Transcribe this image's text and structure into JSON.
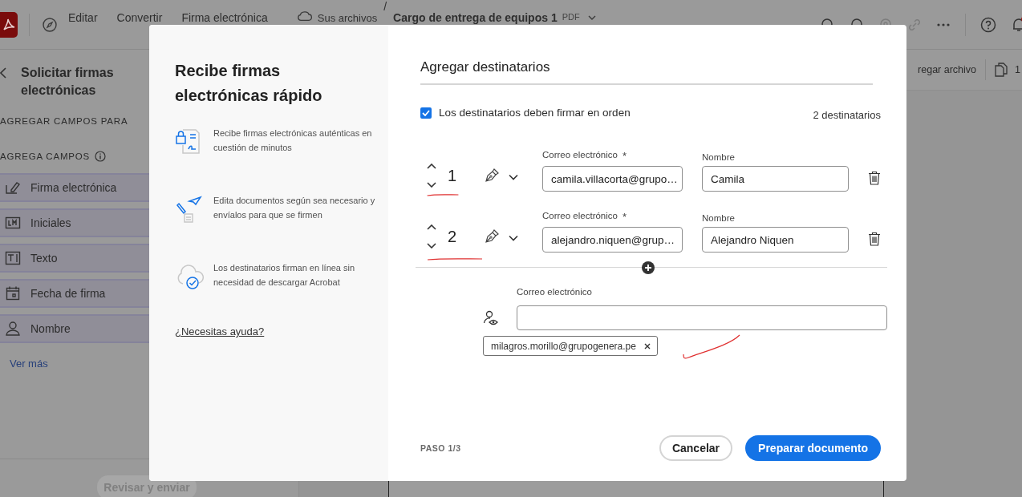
{
  "toolbar": {
    "items": [
      "Editar",
      "Convertir",
      "Firma electrónica"
    ],
    "breadcrumb": "Sus archivos",
    "separator": "/",
    "file_name": "Cargo de entrega de equipos 1",
    "file_type": "PDF",
    "has_notification": true
  },
  "side_panel": {
    "title": "Solicitar firmas electrónicas",
    "section": "AGREGAR CAMPOS PARA",
    "fields_heading": "AGREGA CAMPOS",
    "fields": [
      {
        "kind": "signature",
        "label": "Firma electrónica"
      },
      {
        "kind": "initials",
        "label": "Iniciales"
      },
      {
        "kind": "text",
        "label": "Texto"
      },
      {
        "kind": "date",
        "label": "Fecha de firma"
      },
      {
        "kind": "name",
        "label": "Nombre"
      }
    ],
    "more": "Ver más",
    "review_button": {
      "label": "Revisar y enviar",
      "disabled": true
    }
  },
  "document_toolbar": {
    "add_file": "regar archivo",
    "page_count": "1"
  },
  "dialog": {
    "intro": {
      "title": "Recibe firmas electrónicas rápido",
      "features": [
        {
          "kind": "secure",
          "text": "Recibe firmas electrónicas auténticas en cuestión de minutos"
        },
        {
          "kind": "send",
          "text": "Edita documentos según sea necesario y envíalos para que se firmen"
        },
        {
          "kind": "cloud",
          "text": "Los destinatarios firman en línea sin necesidad de descargar Acrobat"
        }
      ],
      "help_link": "¿Necesitas ayuda?"
    },
    "recipients": {
      "title": "Agregar destinatarios",
      "sign_in_order": {
        "label": "Los destinatarios deben firmar en orden",
        "checked": true
      },
      "count": "2 destinatarios",
      "list": [
        {
          "order": "1",
          "email_label": "Correo electrónico",
          "required_mark": "*",
          "email": "camila.villacorta@grupo…",
          "name_label": "Nombre",
          "name": "Camila"
        },
        {
          "order": "2",
          "email_label": "Correo electrónico",
          "required_mark": "*",
          "email": "alejandro.niquen@grup…",
          "name_label": "Nombre",
          "name": "Alejandro Niquen"
        }
      ],
      "cc": {
        "label": "Correo electrónico",
        "chips": [
          "milagros.morillo@grupogenera.pe"
        ]
      }
    },
    "footer": {
      "step": "PASO 1/3",
      "cancel": "Cancelar",
      "primary": "Preparar documento"
    }
  }
}
